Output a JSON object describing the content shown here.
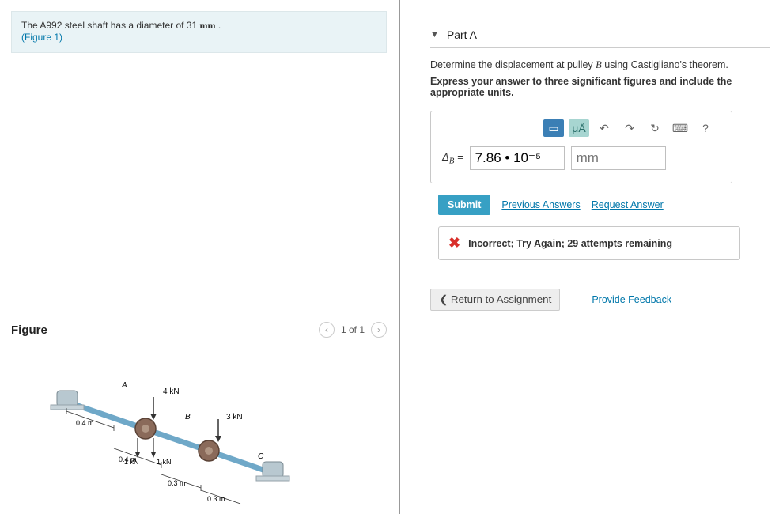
{
  "problem": {
    "text_a": "The A992 steel shaft has a diameter of 31 ",
    "unit": "mm",
    "text_b": " .",
    "figure_link": "(Figure 1)"
  },
  "figure": {
    "title": "Figure",
    "pager": "1 of 1",
    "labels": {
      "A": "A",
      "B": "B",
      "C": "C",
      "f4kn": "4 kN",
      "f3kn": "3 kN",
      "f1knL": "1 kN",
      "f1knR": "1 kN",
      "d04a": "0.4 m",
      "d04b": "0.4 m",
      "d03a": "0.3 m",
      "d03b": "0.3 m"
    }
  },
  "part": {
    "title": "Part A",
    "instruction1_a": "Determine the displacement at pulley ",
    "instruction1_b": "B",
    "instruction1_c": " using Castigliano's theorem.",
    "instruction2": "Express your answer to three significant figures and include the appropriate units.",
    "toolbar": {
      "templates": "▭",
      "units": "μÅ",
      "undo": "↶",
      "redo": "↷",
      "reset": "↻",
      "keyboard": "⌨",
      "help": "?"
    },
    "answer": {
      "label_a": "Δ",
      "label_b": "B",
      "equals": " = ",
      "value": "7.86 • 10⁻⁵",
      "unit_placeholder": "mm"
    },
    "submit": "Submit",
    "prev_answers": "Previous Answers",
    "request_answer": "Request Answer",
    "feedback": "Incorrect; Try Again; 29 attempts remaining"
  },
  "bottom": {
    "return": "Return to Assignment",
    "feedback": "Provide Feedback"
  }
}
